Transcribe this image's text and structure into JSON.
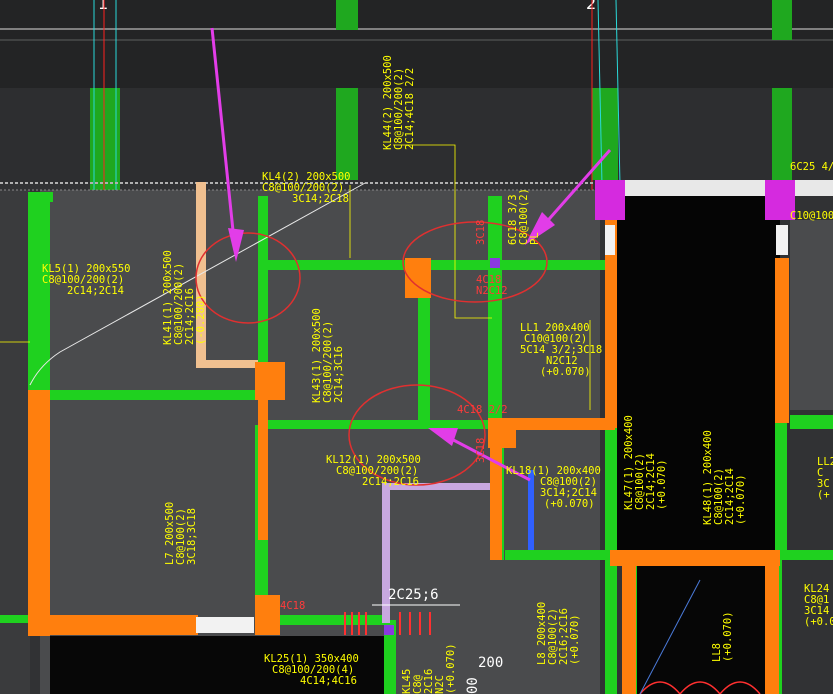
{
  "grid_axes": [
    "1",
    "2"
  ],
  "labels": {
    "kl5": [
      "KL5(1) 200x550",
      "C8@100/200(2)",
      "2C14;2C14"
    ],
    "kl4": [
      "KL4(2) 200x500",
      "C8@100/200(2)",
      "3C14;2C18"
    ],
    "kl44": [
      "KL44(2) 200x500",
      "C8@100/200(2)",
      "2C14;4C18 2/2"
    ],
    "kl41": [
      "KL41(1) 200x500",
      "C8@100/200(2)",
      "2C14;2C16",
      "(-0.280)"
    ],
    "kl43": [
      "KL43(1) 200x500",
      "C8@100/200(2)",
      "2C14;3C16"
    ],
    "kl12": [
      "KL12(1) 200x500",
      "C8@100/200(2)",
      "2C14;2C16"
    ],
    "ll1": [
      "LL1 200x400",
      "C10@100(2)",
      "5C14 3/2;3C18",
      "N2C12",
      "(+0.070)"
    ],
    "kl18": [
      "KL18(1) 200x400",
      "C8@100(2)",
      "3C14;2C14",
      "(+0.070)"
    ],
    "kl47": [
      "KL47(1) 200x400",
      "C8@100(2)",
      "2C14;2C14",
      "(+0.070)"
    ],
    "kl48": [
      "KL48(1) 200x400",
      "C8@100(2)",
      "2C14;2C14",
      "(+0.070)"
    ],
    "l7": [
      "L7 200x500",
      "C8@100(2)",
      "3C18;3C18"
    ],
    "kl25": [
      "KL25(1) 350x400",
      "C8@100/200(4)",
      "4C14;4C16"
    ],
    "l8": [
      "L8 200x400",
      "C8@100(2)",
      "2C16;2C16",
      "(+0.070)"
    ],
    "ll8": [
      "LL8",
      "(+0.070)"
    ],
    "kl24": [
      "KL24",
      "C8@1",
      "3C14",
      "(+0.0"
    ],
    "ll2": [
      "LL2",
      "C",
      "3C",
      "(+"
    ],
    "kl45": [
      "KL45",
      "C8@",
      "2C16",
      "N2C",
      "(+0.070)"
    ],
    "kl_top_right": [
      "6C18 3/3",
      "C8@100(2)",
      "PL"
    ],
    "top_right_strip": "6C25 4/",
    "right_c10": "C10@100",
    "n2c12_a": [
      "4C18",
      "N2C12"
    ],
    "small_3c18": "3C18",
    "c4c18_2_2": "4C18 2/2",
    "c3c18_v": "3C18",
    "c4c18_bottom": "4C18",
    "c2c25": "2C25;6",
    "dim_200": "200",
    "dim_00": "00"
  },
  "colors": {
    "background": "#313234",
    "beam_green": "#1fd11f",
    "column_orange": "#ff7f0e",
    "magenta": "#e23de8",
    "annotation_circle": "#e03030",
    "text_yellow": "#ffff00",
    "axis_red": "#ff2020",
    "axis_cyan": "#2ad9d9"
  }
}
